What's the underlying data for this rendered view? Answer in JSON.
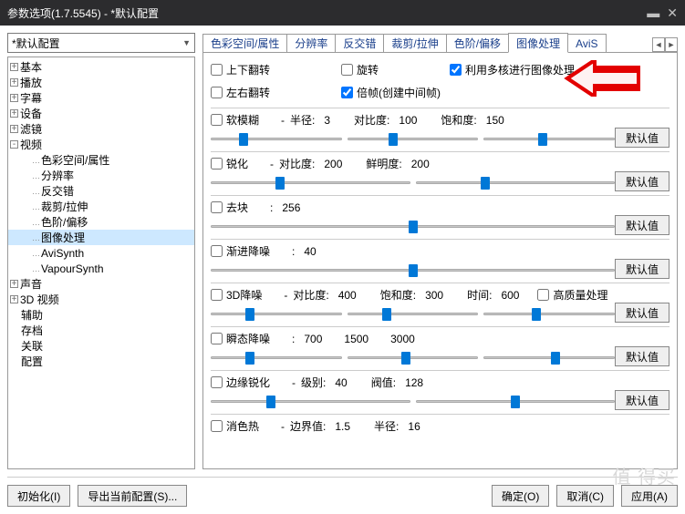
{
  "window": {
    "title": "参数选项(1.7.5545) - *默认配置",
    "min_icon": "▬",
    "close_icon": "✕"
  },
  "config_combo": "*默认配置",
  "tree": {
    "root": [
      {
        "label": "基本",
        "exp": "+"
      },
      {
        "label": "播放",
        "exp": "+"
      },
      {
        "label": "字幕",
        "exp": "+"
      },
      {
        "label": "设备",
        "exp": "+"
      },
      {
        "label": "滤镜",
        "exp": "+"
      },
      {
        "label": "视频",
        "exp": "-",
        "children": [
          "色彩空间/属性",
          "分辨率",
          "反交错",
          "裁剪/拉伸",
          "色阶/偏移",
          "图像处理",
          "AviSynth",
          "VapourSynth"
        ]
      },
      {
        "label": "声音",
        "exp": "+"
      },
      {
        "label": "3D 视频",
        "exp": "+"
      },
      {
        "label": "辅助",
        "exp": ""
      },
      {
        "label": "存档",
        "exp": ""
      },
      {
        "label": "关联",
        "exp": ""
      },
      {
        "label": "配置",
        "exp": ""
      }
    ],
    "selected": "图像处理"
  },
  "tabs": {
    "items": [
      "色彩空间/属性",
      "分辨率",
      "反交错",
      "裁剪/拉伸",
      "色阶/偏移",
      "图像处理",
      "AviS"
    ],
    "active": "图像处理",
    "nav_left": "◄",
    "nav_right": "►"
  },
  "panel": {
    "top_checks": {
      "flip_v": "上下翻转",
      "flip_h": "左右翻转",
      "rotate": "旋转",
      "double_frame": "倍帧(创建中间帧)",
      "multicore": "利用多核进行图像处理"
    },
    "default_btn": "默认值",
    "sections": [
      {
        "id": "blur",
        "chk": "软模糊",
        "parts": [
          [
            "半径",
            "3"
          ],
          [
            "对比度",
            "100"
          ],
          [
            "饱和度",
            "150"
          ]
        ],
        "sliders": [
          25,
          35,
          45
        ]
      },
      {
        "id": "sharpen",
        "chk": "锐化",
        "parts": [
          [
            "对比度",
            "200"
          ],
          [
            "鲜明度",
            "200"
          ]
        ],
        "sliders": [
          35,
          35
        ]
      },
      {
        "id": "deblock",
        "chk": "去块",
        "parts": [
          [
            "",
            "256"
          ]
        ],
        "sliders": [
          50
        ]
      },
      {
        "id": "grad",
        "chk": "渐进降噪",
        "parts": [
          [
            "",
            "40"
          ]
        ],
        "sliders": [
          50
        ]
      },
      {
        "id": "dn3d",
        "chk": "3D降噪",
        "parts": [
          [
            "对比度",
            "400"
          ],
          [
            "饱和度",
            "300"
          ],
          [
            "时间",
            "600"
          ]
        ],
        "extra_chk": "高质量处理",
        "sliders": [
          30,
          30,
          40
        ]
      },
      {
        "id": "temporal",
        "chk": "瞬态降噪",
        "parts": [
          [
            "",
            "700"
          ],
          [
            "",
            "1500"
          ],
          [
            "",
            "3000"
          ]
        ],
        "sliders": [
          30,
          45,
          55
        ]
      },
      {
        "id": "edge",
        "chk": "边缘锐化",
        "parts": [
          [
            "级别",
            "40"
          ],
          [
            "阀值",
            "128"
          ]
        ],
        "sliders": [
          30,
          50
        ]
      },
      {
        "id": "last",
        "chk": "消色热",
        "parts": [
          [
            "边界值",
            "1.5"
          ],
          [
            "半径",
            "16"
          ]
        ],
        "cut": true
      }
    ]
  },
  "footer": {
    "init": "初始化(I)",
    "export": "导出当前配置(S)...",
    "ok": "确定(O)",
    "cancel": "取消(C)",
    "apply": "应用(A)"
  },
  "watermark": "值  得买"
}
